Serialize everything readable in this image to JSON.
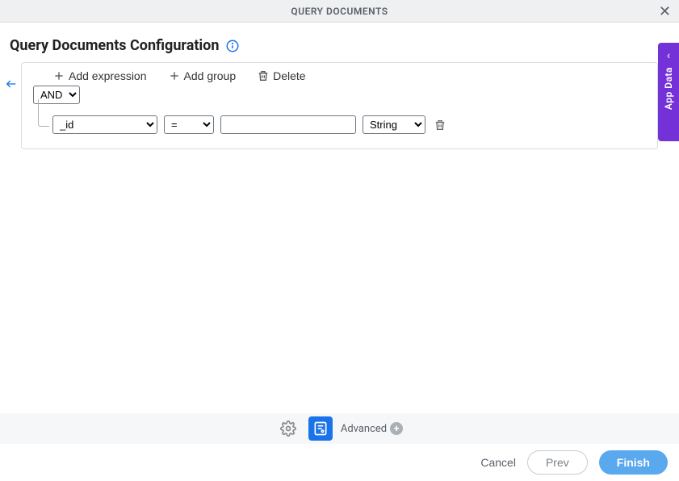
{
  "header": {
    "title": "QUERY DOCUMENTS"
  },
  "page": {
    "title": "Query Documents Configuration"
  },
  "toolbar": {
    "add_expression_label": "Add expression",
    "add_group_label": "Add group",
    "delete_label": "Delete"
  },
  "query": {
    "logic_operator": "AND",
    "expressions": [
      {
        "field": "_id",
        "operator": "=",
        "value": "",
        "type": "String"
      }
    ]
  },
  "side_tab": {
    "label": "App Data"
  },
  "bottom_toolbar": {
    "advanced_label": "Advanced"
  },
  "footer": {
    "cancel_label": "Cancel",
    "prev_label": "Prev",
    "finish_label": "Finish"
  }
}
